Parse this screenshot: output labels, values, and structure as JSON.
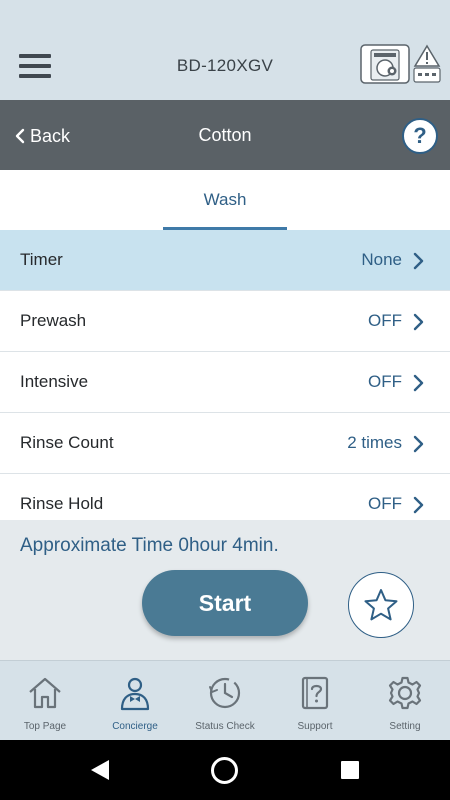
{
  "header": {
    "device_name": "BD-120XGV",
    "menu_icon": "hamburger-menu-icon",
    "status_icon": "washer-warning-icon"
  },
  "nav": {
    "back_label": "Back",
    "title": "Cotton",
    "help_label": "?"
  },
  "tabs": [
    {
      "label": "Wash",
      "active": true
    }
  ],
  "settings": [
    {
      "label": "Timer",
      "value": "None",
      "active": true
    },
    {
      "label": "Prewash",
      "value": "OFF",
      "active": false
    },
    {
      "label": "Intensive",
      "value": "OFF",
      "active": false
    },
    {
      "label": "Rinse Count",
      "value": "2 times",
      "active": false
    },
    {
      "label": "Rinse Hold",
      "value": "OFF",
      "active": false
    }
  ],
  "footer": {
    "approx_time": "Approximate Time 0hour 4min.",
    "start_label": "Start",
    "favorite_icon": "star-icon"
  },
  "bottom_nav": [
    {
      "label": "Top Page",
      "icon": "house-icon",
      "active": false
    },
    {
      "label": "Concierge",
      "icon": "concierge-icon",
      "active": true
    },
    {
      "label": "Status Check",
      "icon": "clock-icon",
      "active": false
    },
    {
      "label": "Support",
      "icon": "support-book-icon",
      "active": false
    },
    {
      "label": "Setting",
      "icon": "gear-icon",
      "active": false
    }
  ],
  "colors": {
    "accent": "#2f5f86",
    "header_bg": "#d6e1e8",
    "navbar_bg": "#5a6166",
    "active_row_bg": "#c8e2ef",
    "start_button": "#4a7a94"
  }
}
